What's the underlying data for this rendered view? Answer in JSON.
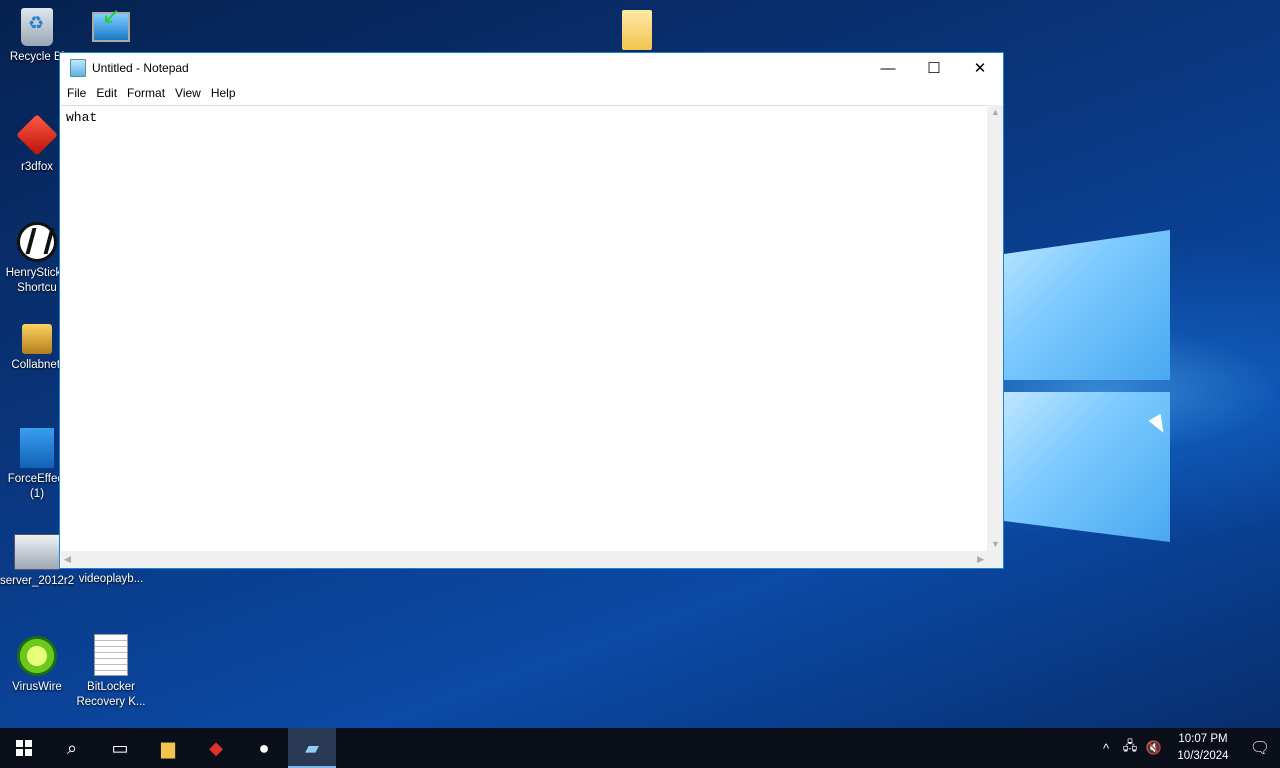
{
  "desktop": {
    "icons": [
      {
        "label": "Recycle Bi",
        "icon": "recycle-bin-icon"
      },
      {
        "label": "",
        "icon": "computer-icon"
      },
      {
        "label": "",
        "icon": "folder-icon"
      },
      {
        "label": "r3dfox",
        "icon": "r3dfox-icon"
      },
      {
        "label": "HenryStick - Shortcu",
        "icon": "henry-shortcut-icon"
      },
      {
        "label": "Collabnetl",
        "icon": "collabnet-icon"
      },
      {
        "label": "ForceEffect (1)",
        "icon": "forceeffect-icon"
      },
      {
        "label": "server_2012r2",
        "icon": "server-icon"
      },
      {
        "label": "videoplayb...",
        "icon": "video-file-icon"
      },
      {
        "label": "VirusWire",
        "icon": "viruswire-icon"
      },
      {
        "label": "BitLocker Recovery K...",
        "icon": "text-document-icon"
      }
    ]
  },
  "notepad": {
    "title": "Untitled - Notepad",
    "menu": [
      "File",
      "Edit",
      "Format",
      "View",
      "Help"
    ],
    "content": "what",
    "controls": {
      "minimize": "—",
      "maximize": "☐",
      "close": "✕"
    }
  },
  "taskbar": {
    "apps": [
      "start-icon",
      "search-icon",
      "task-view-icon",
      "file-explorer-icon",
      "r3dfox-icon",
      "henry-icon",
      "notepad-icon"
    ],
    "tray": {
      "chevron": "^",
      "network": "🖧",
      "volume": "🔇"
    },
    "time": "10:07 PM",
    "date": "10/3/2024",
    "notification": "🗨"
  },
  "colors": {
    "accent": "#1883d7",
    "taskbar": "#0a0f1a"
  }
}
